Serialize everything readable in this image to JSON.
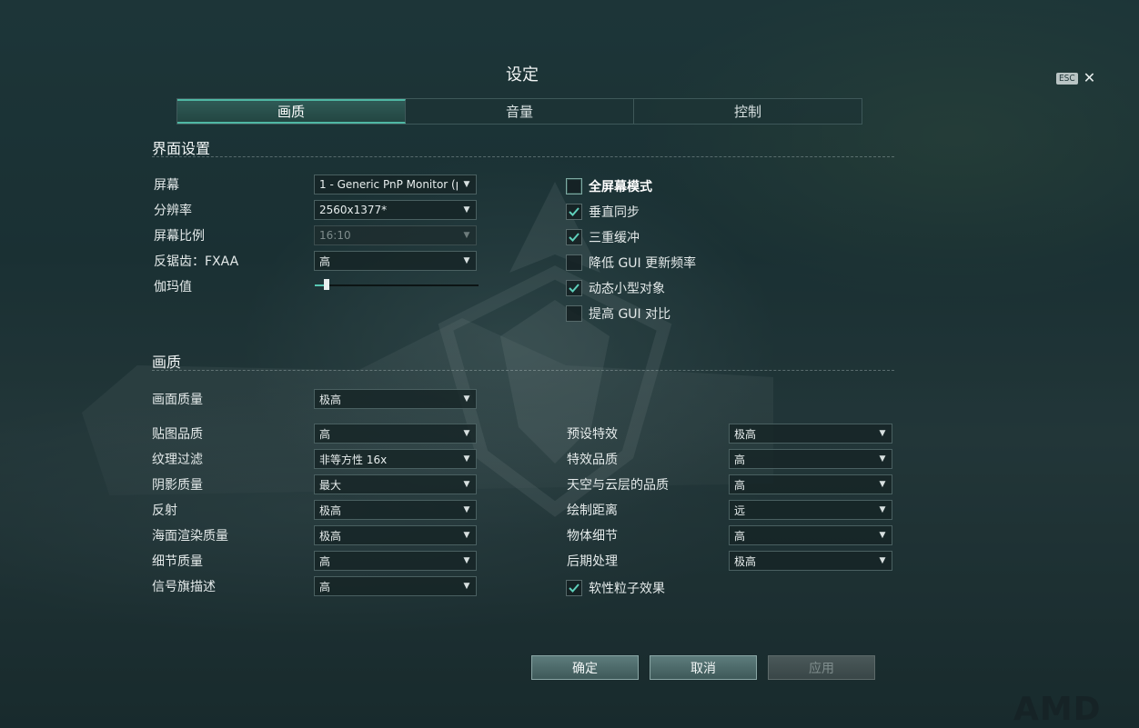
{
  "window": {
    "title": "设定",
    "esc_label": "ESC",
    "close_glyph": "✕"
  },
  "tabs": [
    {
      "label": "画质",
      "active": true
    },
    {
      "label": "音量",
      "active": false
    },
    {
      "label": "控制",
      "active": false
    }
  ],
  "interface": {
    "title": "界面设置",
    "rows": [
      {
        "label": "屏幕",
        "value": "1 - Generic PnP Monitor (pı",
        "disabled": false
      },
      {
        "label": "分辨率",
        "value": "2560x1377*",
        "disabled": false
      },
      {
        "label": "屏幕比例",
        "value": "16:10",
        "disabled": true
      },
      {
        "label": "反锯齿：FXAA",
        "value": "高",
        "disabled": false
      }
    ],
    "gamma": {
      "label": "伽玛值",
      "level": 0.07
    },
    "checks": [
      {
        "label": "全屏幕模式",
        "checked": false
      },
      {
        "label": "垂直同步",
        "checked": true
      },
      {
        "label": "三重缓冲",
        "checked": true
      },
      {
        "label": "降低 GUI 更新频率",
        "checked": false
      },
      {
        "label": "动态小型对象",
        "checked": true
      },
      {
        "label": "提高 GUI 对比",
        "checked": false
      }
    ]
  },
  "quality": {
    "title": "画质",
    "overall": {
      "label": "画面质量",
      "value": "极高"
    },
    "left": [
      {
        "label": "贴图品质",
        "value": "高"
      },
      {
        "label": "纹理过滤",
        "value": "非等方性 16x"
      },
      {
        "label": "阴影质量",
        "value": "最大"
      },
      {
        "label": "反射",
        "value": "极高"
      },
      {
        "label": "海面渲染质量",
        "value": "极高"
      },
      {
        "label": "细节质量",
        "value": "高"
      },
      {
        "label": "信号旗描述",
        "value": "高"
      }
    ],
    "right": [
      {
        "label": "预设特效",
        "value": "极高"
      },
      {
        "label": "特效品质",
        "value": "高"
      },
      {
        "label": "天空与云层的品质",
        "value": "高"
      },
      {
        "label": "绘制距离",
        "value": "远"
      },
      {
        "label": "物体细节",
        "value": "高"
      },
      {
        "label": "后期处理",
        "value": "极高"
      }
    ],
    "soft_particles": {
      "label": "软性粒子效果",
      "checked": true
    }
  },
  "buttons": {
    "ok": "确定",
    "cancel": "取消",
    "apply": "应用"
  },
  "icons": {
    "dropdown": "chevron-down-icon",
    "check": "checkmark-icon",
    "close": "close-icon"
  },
  "colors": {
    "accent": "#4fb7a4",
    "check": "#5fd0bb"
  },
  "watermark": "AMD"
}
